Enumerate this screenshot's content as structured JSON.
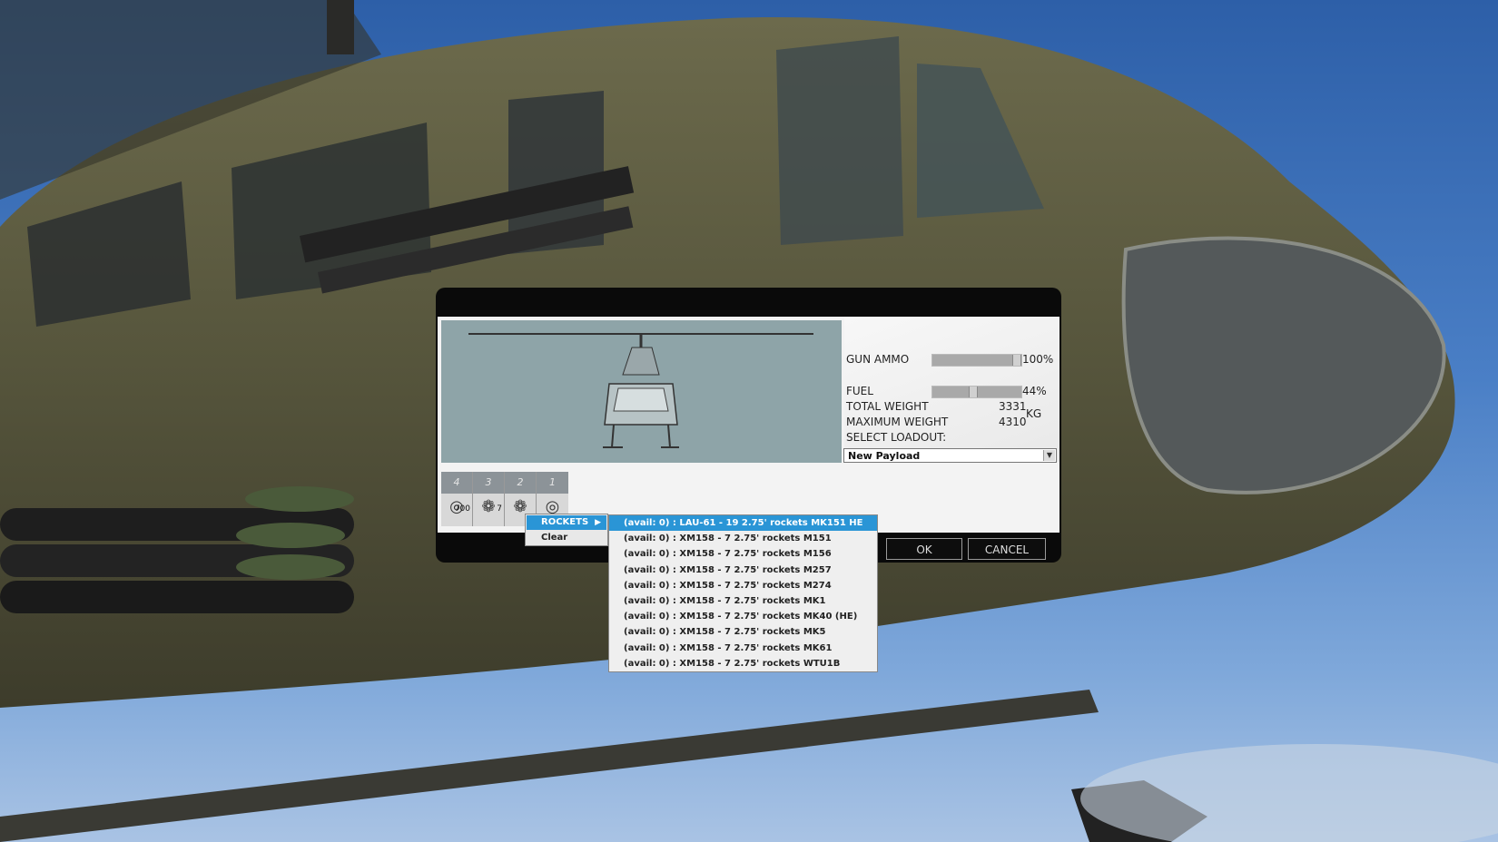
{
  "stats": {
    "gun_ammo_label": "GUN AMMO",
    "gun_ammo_pct": "100%",
    "gun_ammo_value": 1.0,
    "fuel_label": "FUEL",
    "fuel_pct": "44%",
    "fuel_value": 0.44,
    "total_weight_label": "TOTAL WEIGHT",
    "total_weight_value": "3331",
    "max_weight_label": "MAXIMUM WEIGHT",
    "max_weight_value": "4310",
    "weight_unit": "KG",
    "select_loadout_label": "SELECT LOADOUT:",
    "loadout_value": "New Payload"
  },
  "pylons": [
    {
      "num": "4",
      "icon": "gauge-icon",
      "count": "700"
    },
    {
      "num": "3",
      "icon": "rocket-pod-icon",
      "count": "7"
    },
    {
      "num": "2",
      "icon": "rocket-pod-icon",
      "count": ""
    },
    {
      "num": "1",
      "icon": "gauge-icon",
      "count": ""
    }
  ],
  "buttons": {
    "ok": "OK",
    "cancel": "CANCEL"
  },
  "context_menu": {
    "rockets": "ROCKETS",
    "clear": "Clear"
  },
  "submenu": [
    "(avail:     0) : LAU-61 - 19 2.75' rockets MK151 HE",
    "(avail:     0) : XM158 - 7 2.75' rockets M151",
    "(avail:     0) : XM158 - 7 2.75' rockets M156",
    "(avail:     0) : XM158 - 7 2.75' rockets M257",
    "(avail:     0) : XM158 - 7 2.75' rockets M274",
    "(avail:     0) : XM158 - 7 2.75' rockets MK1",
    "(avail:     0) : XM158 - 7 2.75' rockets MK40 (HE)",
    "(avail:     0) : XM158 - 7 2.75' rockets MK5",
    "(avail:     0) : XM158 - 7 2.75' rockets MK61",
    "(avail:     0) : XM158 - 7 2.75' rockets WTU1B"
  ],
  "colors": {
    "highlight": "#2a95d6",
    "dialog_bg": "#0a0a0a",
    "preview_bg": "#8ea4a8"
  }
}
